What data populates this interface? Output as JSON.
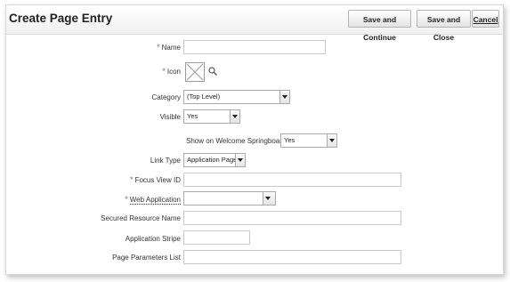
{
  "page": {
    "title": "Create Page Entry"
  },
  "toolbar": {
    "save_continue_label": "Save and Continue",
    "save_close_label": "Save and Close",
    "cancel_label": "Cancel"
  },
  "form": {
    "name_label": "Name",
    "icon_label": "Icon",
    "category_label": "Category",
    "category_value": "(Top Level)",
    "visible_label": "Visible",
    "visible_value": "Yes",
    "welcome_label": "Show on Welcome Springboard",
    "welcome_value": "Yes",
    "link_type_label": "Link Type",
    "link_type_value": "Application Page",
    "focus_view_label": "Focus View ID",
    "web_app_label": "Web Application",
    "secured_label": "Secured Resource Name",
    "stripe_label": "Application Stripe",
    "params_label": "Page Parameters List",
    "required_marker": "*"
  }
}
